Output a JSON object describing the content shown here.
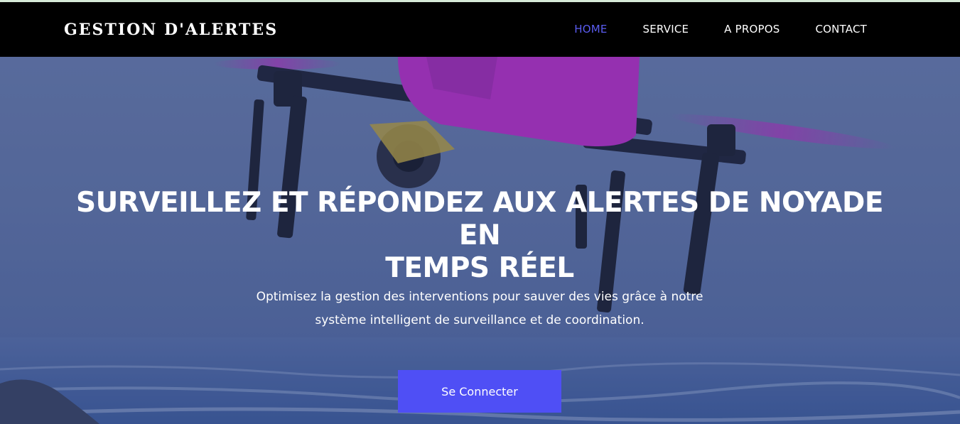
{
  "header": {
    "brand": "GESTION D'ALERTES",
    "nav": [
      {
        "label": "HOME",
        "active": true
      },
      {
        "label": "SERVICE",
        "active": false
      },
      {
        "label": "A PROPOS",
        "active": false
      },
      {
        "label": "CONTACT",
        "active": false
      }
    ]
  },
  "hero": {
    "title_line1": "SURVEILLEZ ET RÉPONDEZ AUX ALERTES DE NOYADE EN",
    "title_line2": "TEMPS RÉEL",
    "subtitle_line1": "Optimisez la gestion des interventions pour sauver des vies grâce à notre",
    "subtitle_line2": "système intelligent de surveillance et de coordination.",
    "cta_label": "Se Connecter",
    "background_image": "drone-over-sea"
  },
  "colors": {
    "navbar_bg": "#000000",
    "nav_active": "#5a5cf0",
    "cta_bg": "#4f4ff5",
    "drone_body": "#c02ec9"
  }
}
